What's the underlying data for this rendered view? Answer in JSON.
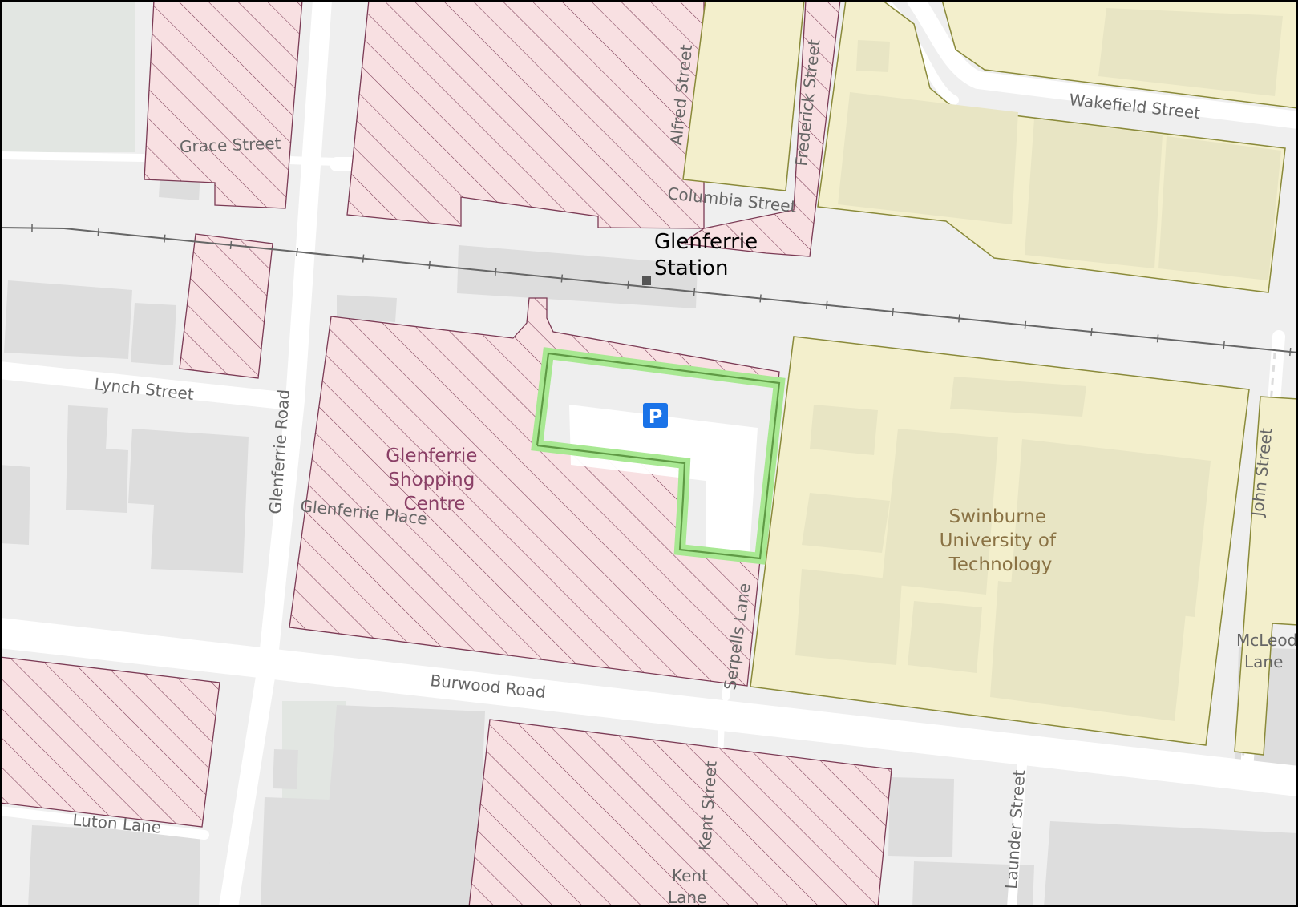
{
  "map": {
    "colors": {
      "land": "#efefef",
      "road": "#ffffff",
      "building": "#dddddd",
      "park": "#e2e6e2",
      "retail_fill": "#f8e0e2",
      "retail_stroke": "#7b3b55",
      "university_fill": "#f3efcc",
      "university_stroke": "#8a8a3a",
      "university_building": "#e8e5c4",
      "parking_outline": "#a8e892",
      "parking_outline_dark": "#5f9a45",
      "parking_icon": "#1a73e8",
      "railway": "#666666",
      "label_text": "#666666",
      "retail_label": "#8a3f66",
      "university_label": "#8a7244",
      "frame": "#000000"
    },
    "railway": {
      "name": "",
      "station_marker": "square"
    },
    "stations": [
      {
        "id": "glenferrie",
        "lines": [
          "Glenferrie",
          "Station"
        ]
      }
    ],
    "pois": [
      {
        "id": "shopping-centre",
        "type": "retail",
        "lines": [
          "Glenferrie",
          "Shopping",
          "Centre"
        ]
      },
      {
        "id": "university",
        "type": "university",
        "lines": [
          "Swinburne",
          "University of",
          "Technology"
        ]
      },
      {
        "id": "parking",
        "type": "parking",
        "icon": "parking-icon",
        "symbol": "P"
      }
    ],
    "streets": {
      "grace_street": "Grace Street",
      "alfred_street": "Alfred Street",
      "frederick_street": "Frederick Street",
      "wakefield_street": "Wakefield Street",
      "columbia_street": "Columbia Street",
      "lynch_street": "Lynch Street",
      "glenferrie_road": "Glenferrie Road",
      "glenferrie_place": "Glenferrie Place",
      "john_street": "John Street",
      "mcleod_lane": [
        "McLeod",
        "Lane"
      ],
      "serpells_lane": "Serpells Lane",
      "burwood_road": "Burwood Road",
      "kent_street": "Kent Street",
      "kent_lane": [
        "Kent",
        "Lane"
      ],
      "launder_street": "Launder Street",
      "luton_lane": "Luton Lane"
    }
  }
}
